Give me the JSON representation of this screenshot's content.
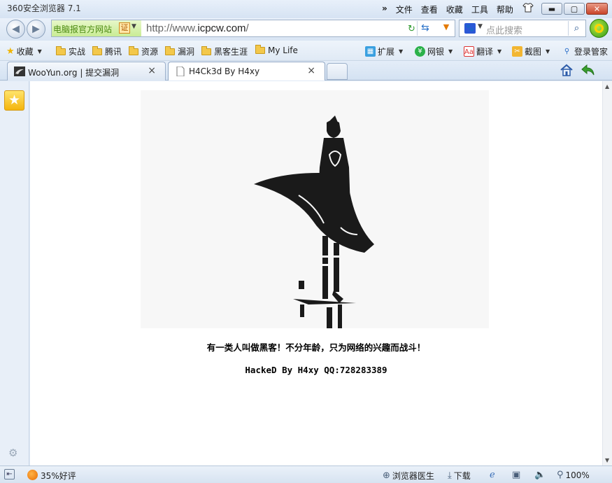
{
  "window": {
    "title": "360安全浏览器 7.1",
    "menu": [
      "文件",
      "查看",
      "收藏",
      "工具",
      "帮助"
    ],
    "overflow_glyph": "»"
  },
  "navigation": {
    "cert_label": "电脑报官方网站",
    "cert_badge": "证",
    "url_prefix": "http://www.",
    "url_domain": "icpcw.com",
    "url_suffix": "/",
    "search_placeholder": "点此搜索"
  },
  "favorites": {
    "bookmarks_label": "收藏",
    "folders": [
      "实战",
      "腾讯",
      "资源",
      "漏洞",
      "黑客生涯",
      "My Life"
    ],
    "tools": [
      "扩展",
      "网银",
      "翻译",
      "截图",
      "登录管家"
    ]
  },
  "tabs": [
    {
      "title": "WooYun.org | 提交漏洞",
      "active": false
    },
    {
      "title": "H4Ck3d By H4xy",
      "active": true
    }
  ],
  "page": {
    "line1": "有一类人叫做黑客！不分年龄，只为网络的兴趣而战斗！",
    "line2": "HackeD By H4xy QQ:728283389"
  },
  "status": {
    "rating": "35%好评",
    "doctor": "浏览器医生",
    "download": "下载",
    "zoom": "100%"
  }
}
